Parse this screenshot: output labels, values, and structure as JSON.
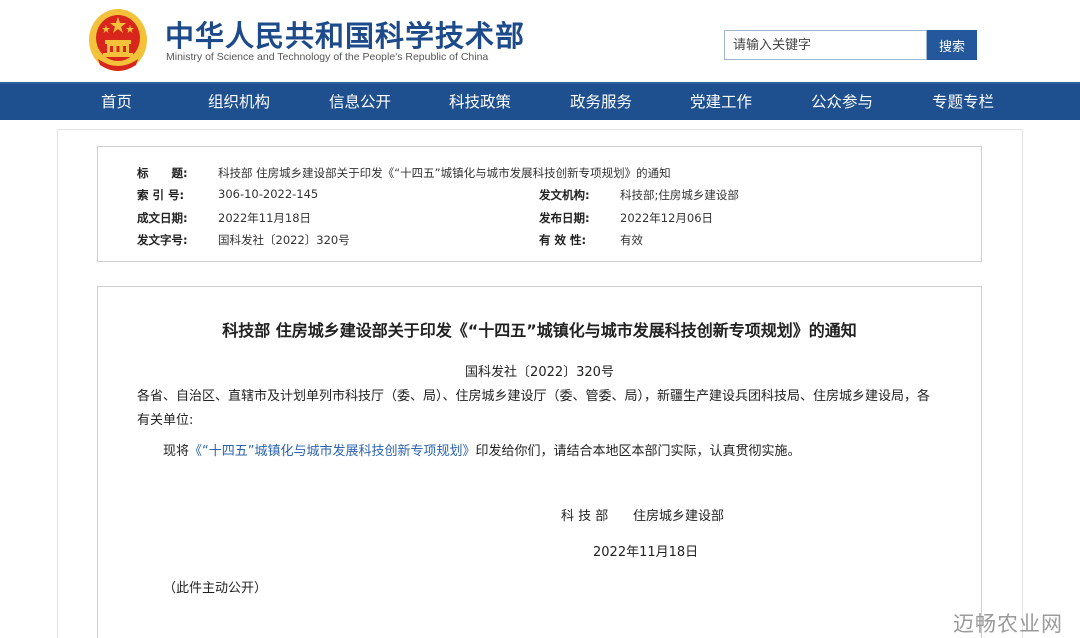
{
  "header": {
    "title": "中华人民共和国科学技术部",
    "subtitle": "Ministry of Science and Technology of the People's Republic of China",
    "search_placeholder": "请输入关键字",
    "search_button": "搜索",
    "emblem_icon": "national-emblem-icon"
  },
  "nav": {
    "items": [
      "首页",
      "组织机构",
      "信息公开",
      "科技政策",
      "政务服务",
      "党建工作",
      "公众参与",
      "专题专栏"
    ]
  },
  "meta": {
    "title_label": "标　　题:",
    "title_value": "科技部 住房城乡建设部关于印发《“十四五”城镇化与城市发展科技创新专项规划》的通知",
    "index_label": "索 引 号:",
    "index_value": "306-10-2022-145",
    "issuer_label": "发文机构:",
    "issuer_value": "科技部;住房城乡建设部",
    "created_label": "成文日期:",
    "created_value": "2022年11月18日",
    "published_label": "发布日期:",
    "published_value": "2022年12月06日",
    "docno_label": "发文字号:",
    "docno_value": "国科发社〔2022〕320号",
    "validity_label": "有 效 性:",
    "validity_value": "有效"
  },
  "document": {
    "title": "科技部 住房城乡建设部关于印发《“十四五”城镇化与城市发展科技创新专项规划》的通知",
    "number": "国科发社〔2022〕320号",
    "recipients_line1": "各省、自治区、直辖市及计划单列市科技厅（委、局）、住房城乡建设厅（委、管委、局），新疆生产建设兵团科技局、住房城乡建设局，各",
    "recipients_line2": "有关单位:",
    "body_prefix": "现将",
    "body_link": "《“十四五”城镇化与城市发展科技创新专项规划》",
    "body_suffix": "印发给你们，请结合本地区本部门实际，认真贯彻实施。",
    "signer1": "科 技 部",
    "signer2": "住房城乡建设部",
    "date": "2022年11月18日",
    "disclosure": "（此件主动公开）"
  },
  "watermark": "迈畅农业网",
  "colors": {
    "brand_blue": "#1e4f8f",
    "title_blue": "#1c4a8a",
    "link_blue": "#2b63b0",
    "emblem_red": "#d8261c",
    "emblem_gold": "#f3c23a"
  }
}
